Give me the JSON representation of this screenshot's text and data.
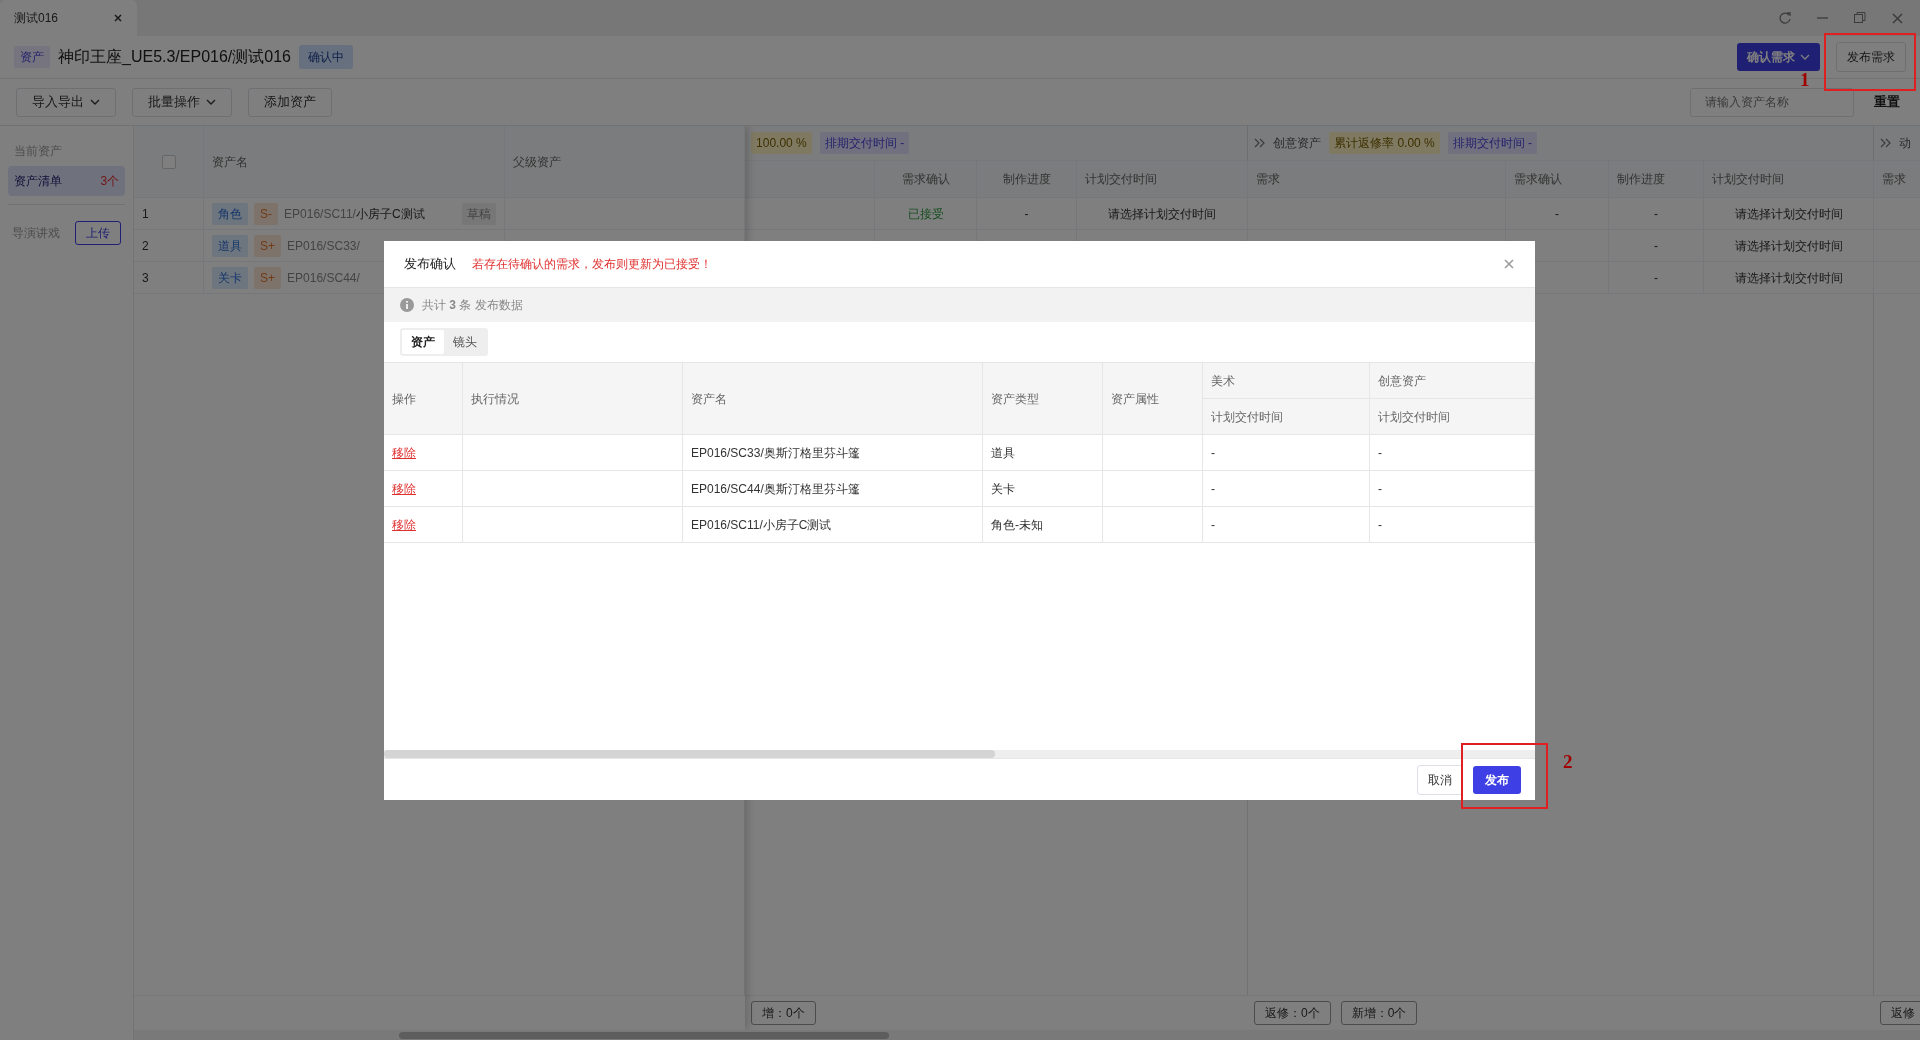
{
  "window": {
    "tab": {
      "label": "测试016"
    }
  },
  "header": {
    "type_badge": "资产",
    "title": "神印王座_UE5.3/EP016/测试016",
    "status": "确认中",
    "buttons": [
      {
        "label": "确认需求",
        "kind": "primary",
        "dropdown": true
      },
      {
        "label": "发布需求",
        "kind": "default",
        "dropdown": false
      }
    ]
  },
  "toolbar": {
    "buttons": [
      {
        "label": "导入导出",
        "dropdown": true
      },
      {
        "label": "批量操作",
        "dropdown": true
      },
      {
        "label": "添加资产",
        "dropdown": false
      }
    ],
    "search": {
      "placeholder": "请输入资产名称"
    },
    "reset": "重置"
  },
  "sidebar": {
    "title": "当前资产",
    "items": [
      {
        "label": "资产清单",
        "count": "3个",
        "selected": true
      }
    ],
    "director": {
      "label": "导演讲戏",
      "button": "上传"
    }
  },
  "table": {
    "select_all": {
      "checked": false
    },
    "columns": [
      "资产名",
      "父级资产"
    ],
    "groups": [
      {
        "kind": "art",
        "badges": [
          {
            "kind": "rate",
            "text": "100.00 %"
          },
          {
            "kind": "schedule",
            "text": "排期交付时间 -"
          }
        ],
        "columns": [
          null,
          "需求确认",
          "制作进度",
          "计划交付时间"
        ],
        "footer": [
          "增：0个"
        ]
      },
      {
        "kind": "creative",
        "label": "创意资产",
        "badges": [
          {
            "kind": "rate",
            "text": "累计返修率 0.00 %"
          },
          {
            "kind": "schedule",
            "text": "排期交付时间 -"
          }
        ],
        "columns": [
          "需求",
          "需求确认",
          "制作进度",
          "计划交付时间"
        ],
        "footer": [
          "返修：0个",
          "新增：0个"
        ]
      },
      {
        "kind": "action",
        "label": "动",
        "columns": [
          "需求"
        ],
        "footer": [
          "返修"
        ]
      }
    ],
    "rows": [
      {
        "index": "1",
        "type": "角色",
        "grade": "S-",
        "path": "EP016/SC11/",
        "name": "小房子C测试",
        "status": "草稿",
        "cells": [
          [
            null,
            {
              "kind": "status",
              "text": "已接受"
            },
            "-",
            "请选择计划交付时间"
          ],
          [
            null,
            "-",
            "-",
            "请选择计划交付时间"
          ]
        ]
      },
      {
        "index": "2",
        "type": "道具",
        "grade": "S+",
        "path": "EP016/SC33/",
        "cells": [
          [
            null,
            null,
            null,
            null
          ],
          [
            null,
            null,
            "-",
            "请选择计划交付时间"
          ]
        ]
      },
      {
        "index": "3",
        "type": "关卡",
        "grade": "S+",
        "path": "EP016/SC44/",
        "cells": [
          [
            null,
            null,
            null,
            null
          ],
          [
            null,
            null,
            "-",
            "请选择计划交付时间"
          ]
        ]
      }
    ]
  },
  "modal": {
    "title": "发布确认",
    "warning": "若存在待确认的需求，发布则更新为已接受！",
    "info": "共计 **3** 条 发布数据",
    "tabs": [
      {
        "label": "资产",
        "selected": true
      },
      {
        "label": "镜头",
        "selected": false
      }
    ],
    "columns": [
      {
        "label": "操作"
      },
      {
        "label": "执行情况"
      },
      {
        "label": "资产名"
      },
      {
        "label": "资产类型"
      },
      {
        "label": "资产属性"
      },
      {
        "label": "美术",
        "sub": "计划交付时间"
      },
      {
        "label": "创意资产",
        "sub": "计划交付时间"
      }
    ],
    "rows": [
      {
        "cells": [
          "移除",
          null,
          "EP016/SC33/奥斯汀格里芬斗篷",
          "道具",
          null,
          "-",
          "-"
        ]
      },
      {
        "cells": [
          "移除",
          null,
          "EP016/SC44/奥斯汀格里芬斗篷",
          "关卡",
          null,
          "-",
          "-"
        ]
      },
      {
        "cells": [
          "移除",
          null,
          "EP016/SC11/小房子C测试",
          "角色-未知",
          null,
          "-",
          "-"
        ]
      }
    ],
    "buttons": [
      {
        "label": "取消",
        "kind": "default"
      },
      {
        "label": "发布",
        "kind": "primary"
      }
    ]
  },
  "annotations": [
    {
      "label": "1"
    },
    {
      "label": "2"
    }
  ]
}
